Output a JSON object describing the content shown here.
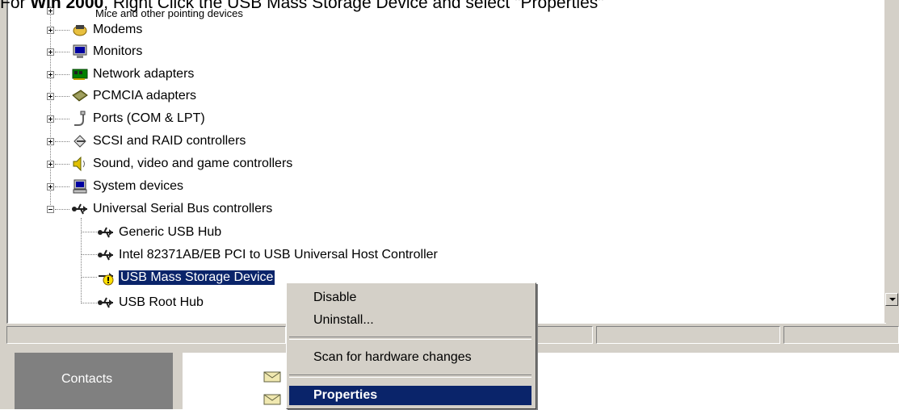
{
  "caption": {
    "prefix": "For ",
    "bold": "Win 2000",
    "suffix": ", Right Click the USB Mass Storage Device and select \"Properties\""
  },
  "tree": {
    "partial_top": "Mice and other pointing devices",
    "categories": [
      {
        "label": "Modems",
        "icon": "modem-icon"
      },
      {
        "label": "Monitors",
        "icon": "monitor-icon"
      },
      {
        "label": "Network adapters",
        "icon": "network-adapter-icon"
      },
      {
        "label": "PCMCIA adapters",
        "icon": "pcmcia-icon"
      },
      {
        "label": "Ports (COM & LPT)",
        "icon": "port-icon"
      },
      {
        "label": "SCSI and RAID controllers",
        "icon": "scsi-icon"
      },
      {
        "label": "Sound, video and game controllers",
        "icon": "sound-icon"
      },
      {
        "label": "System devices",
        "icon": "system-device-icon"
      },
      {
        "label": "Universal Serial Bus controllers",
        "icon": "usb-icon"
      }
    ],
    "usb_children": [
      {
        "label": "Generic USB Hub",
        "icon": "usb-icon"
      },
      {
        "label": "Intel 82371AB/EB PCI to USB Universal Host Controller",
        "icon": "usb-icon"
      },
      {
        "label": "USB Mass Storage Device",
        "icon": "usb-warning-icon",
        "selected": true
      },
      {
        "label": "USB Root Hub",
        "icon": "usb-icon"
      }
    ]
  },
  "context_menu": {
    "items": [
      "Disable",
      "Uninstall...",
      "Scan for hardware changes",
      "Properties"
    ],
    "highlighted": "Properties"
  },
  "outlook": {
    "contacts_label": "Contacts"
  },
  "colors": {
    "selection": "#0a246a",
    "face": "#d4d0c8"
  }
}
